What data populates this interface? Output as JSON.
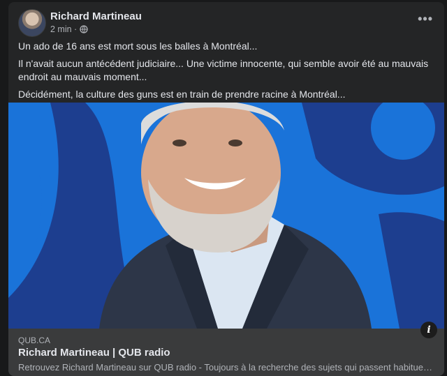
{
  "post": {
    "author": "Richard Martineau",
    "time": "2 min ·",
    "privacy_icon": "globe-icon",
    "more_icon": "more-horizontal-icon",
    "paragraphs": [
      "Un ado de 16 ans est mort sous les balles à Montréal...",
      "Il n'avait aucun antécédent judiciaire... Une victime innocente, qui semble avoir été au mauvais endroit au mauvais moment...",
      "Décidément, la culture des guns est en train de prendre racine à Montréal..."
    ]
  },
  "link": {
    "domain": "QUB.CA",
    "title": "Richard Martineau | QUB radio",
    "description": "Retrouvez Richard Martineau sur QUB radio - Toujours à la recherche des sujets qui passent habituellement...",
    "info_icon": "info-icon"
  },
  "colors": {
    "background": "#18191a",
    "card": "#242526",
    "link_caption": "#3a3b3c",
    "image_blue": "#1a73d9",
    "shape_navy": "#1d3e8f"
  }
}
